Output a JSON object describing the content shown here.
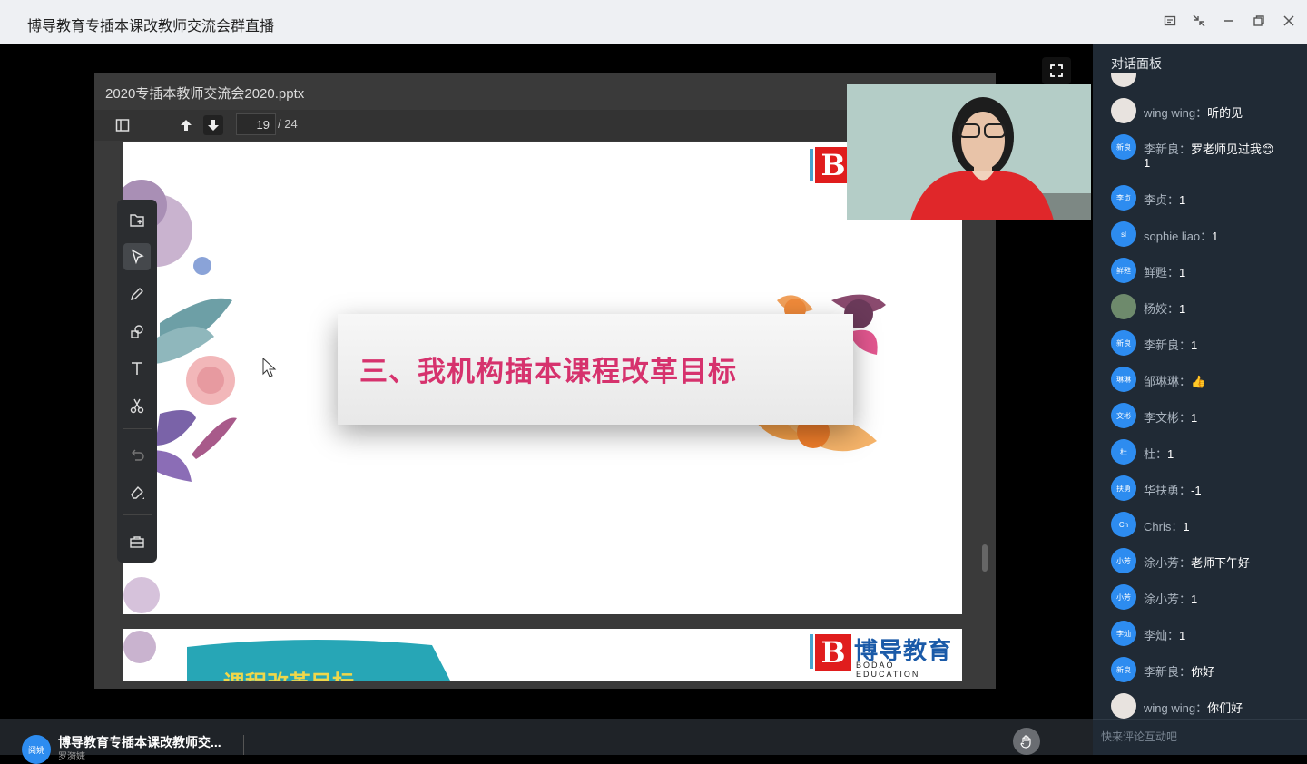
{
  "window": {
    "title": "博导教育专插本课改教师交流会群直播",
    "controls": [
      "share-icon",
      "shrink-icon",
      "minimize-icon",
      "restore-icon",
      "close-icon"
    ]
  },
  "viewer": {
    "file_name": "2020专插本教师交流会2020.pptx",
    "current_page": "19",
    "total_pages": "/ 24"
  },
  "slide": {
    "heading": "三、我机构插本课程改革目标",
    "logo_text": "博导教育",
    "logo_sub": "BODAO EDUCATION",
    "next_heading_partial": "课程改革目标"
  },
  "toolbar": {
    "tools": [
      "add-page-icon",
      "select-pointer-icon",
      "pen-icon",
      "shapes-icon",
      "text-icon",
      "scissors-icon",
      "undo-icon",
      "eraser-icon",
      "toolbox-icon"
    ]
  },
  "bottom": {
    "avatar_text": "阅姚",
    "title": "博导教育专插本课改教师交...",
    "subtitle": "罗漪婕"
  },
  "chat": {
    "header": "对话面板",
    "input_placeholder": "快来评论互动吧",
    "messages": [
      {
        "avatar": "",
        "name": "wing wing",
        "text": "听的见"
      },
      {
        "avatar": "新良",
        "name": "李新良",
        "text": "罗老师见过我😊",
        "line2": "1"
      },
      {
        "avatar": "李贞",
        "name": "李贞",
        "text": "1"
      },
      {
        "avatar": "sl",
        "name": "sophie liao",
        "text": "1"
      },
      {
        "avatar": "鲜甦",
        "name": "鲜甦",
        "text": "1"
      },
      {
        "avatar": "",
        "name": "杨姣",
        "text": "1"
      },
      {
        "avatar": "新良",
        "name": "李新良",
        "text": "1"
      },
      {
        "avatar": "琳琳",
        "name": "邹琳琳",
        "text": "👍"
      },
      {
        "avatar": "文彬",
        "name": "李文彬",
        "text": "1"
      },
      {
        "avatar": "杜",
        "name": "杜",
        "text": "1"
      },
      {
        "avatar": "扶勇",
        "name": "华扶勇",
        "text": "-1"
      },
      {
        "avatar": "Ch",
        "name": "Chris",
        "text": "1"
      },
      {
        "avatar": "小芳",
        "name": "涂小芳",
        "text": "老师下午好"
      },
      {
        "avatar": "小芳",
        "name": "涂小芳",
        "text": "1"
      },
      {
        "avatar": "李灿",
        "name": "李灿",
        "text": "1"
      },
      {
        "avatar": "新良",
        "name": "李新良",
        "text": "你好"
      },
      {
        "avatar": "",
        "name": "wing wing",
        "text": "你们好"
      }
    ]
  },
  "colors": {
    "accent_blue": "#2d8cf0",
    "slide_heading": "#d6326d",
    "chat_bg": "#202a35"
  }
}
